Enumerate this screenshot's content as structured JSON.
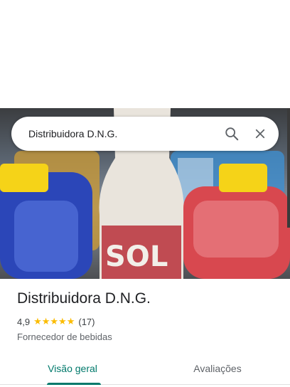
{
  "search": {
    "query": "Distribuidora D.N.G."
  },
  "icons": {
    "search": "search-icon",
    "close": "close-icon",
    "star": "star-icon"
  },
  "place": {
    "name": "Distribuidora D.N.G.",
    "rating": "4,9",
    "stars_glyphs": "★★★★★",
    "review_count": "(17)",
    "category": "Fornecedor de bebidas"
  },
  "tabs": [
    {
      "label": "Visão geral",
      "active": true
    },
    {
      "label": "Avaliações",
      "active": false
    }
  ],
  "colors": {
    "accent": "#00796b",
    "star": "#fbbc04",
    "text": "#202124"
  }
}
